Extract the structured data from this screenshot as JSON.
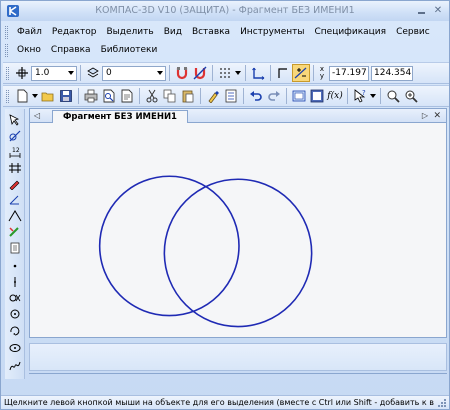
{
  "window": {
    "title": "КОМПАС-3D V10 (ЗАЩИТА) - Фрагмент БЕЗ ИМЕНИ1"
  },
  "menu": {
    "row1": [
      "Файл",
      "Редактор",
      "Выделить",
      "Вид",
      "Вставка",
      "Инструменты",
      "Спецификация",
      "Сервис"
    ],
    "row2": [
      "Окно",
      "Справка",
      "Библиотеки"
    ]
  },
  "toolbar1": {
    "line_width_value": "1.0",
    "layer_value": "0",
    "x_label": "x",
    "y_label": "y",
    "coord_x": "-17.197",
    "coord_y": "124.354"
  },
  "document": {
    "tab_title": "Фрагмент БЕЗ ИМЕНИ1"
  },
  "status": {
    "text": "Щелкните левой кнопкой мыши на объекте для его выделения (вместе с Ctrl или Shift - добавить к выделенным)"
  },
  "colors": {
    "circle_stroke": "#1f2ab4",
    "accent": "#f8d77a"
  }
}
